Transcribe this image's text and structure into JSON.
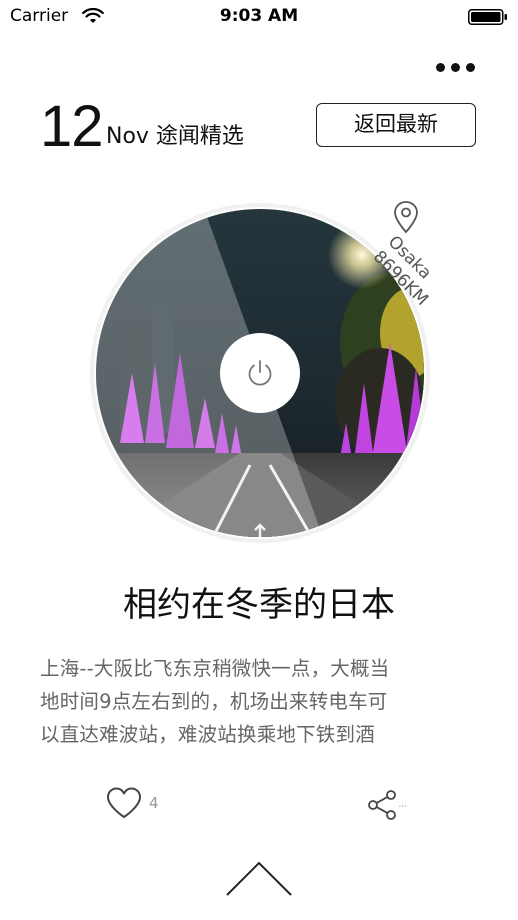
{
  "status_bar": {
    "carrier": "Carrier",
    "time": "9:03 AM"
  },
  "header": {
    "day": "12",
    "month_label": "Nov 途闻精选",
    "return_button": "返回最新"
  },
  "location": {
    "city": "Osaka",
    "distance": "8696KM"
  },
  "article": {
    "title": "相约在冬季的日本",
    "excerpt": "上海--大阪比飞东京稍微快一点，大概当\n地时间9点左右到的，机场出来转电车可\n以直达难波站，难波站换乘地下铁到酒"
  },
  "actions": {
    "like_count": "4",
    "share_more": "..."
  },
  "icons": [
    "wifi-icon",
    "battery-icon",
    "more-icon",
    "location-pin-icon",
    "power-icon",
    "heart-icon",
    "share-icon",
    "chevron-up-icon"
  ]
}
